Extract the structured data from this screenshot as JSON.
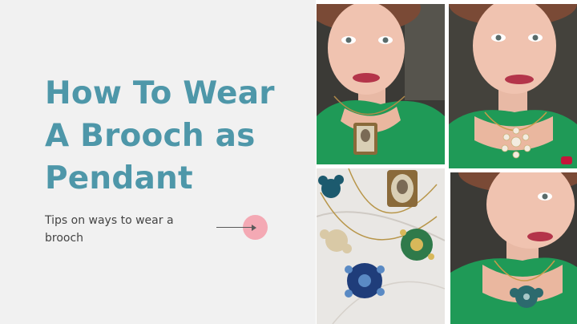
{
  "slide": {
    "title_lines": [
      "How To Wear",
      "A Brooch as",
      "Pendant"
    ],
    "subtitle_lines": [
      "Tips on ways to wear a",
      "brooch"
    ]
  },
  "photos": [
    {
      "name": "portrait-photo-cameo-pendant",
      "icon": "portrait-photo"
    },
    {
      "name": "portrait-photo-crystal-pendant",
      "icon": "portrait-photo"
    },
    {
      "name": "brooch-flatlay-photo",
      "icon": "flatlay-photo"
    },
    {
      "name": "portrait-photo-blue-pendant",
      "icon": "portrait-photo"
    }
  ],
  "colors": {
    "title": "#4e97a9",
    "accent_dot": "#f4a9b4",
    "left_panel": "#f1f1f1",
    "dress": "#1f9a57"
  }
}
